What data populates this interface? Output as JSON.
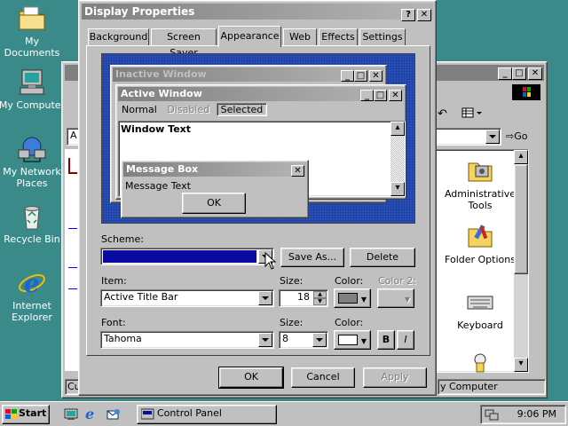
{
  "desktop": {
    "icons": [
      {
        "label": "My Documents"
      },
      {
        "label": "My Computer"
      },
      {
        "label": "My Network Places"
      },
      {
        "label": "Recycle Bin"
      },
      {
        "label": "Internet Explorer"
      }
    ]
  },
  "control_panel": {
    "go_label": "Go",
    "status_left": "Cus",
    "status_right": "y Computer",
    "address_prefix": "A",
    "items": [
      {
        "label": "Administrative Tools"
      },
      {
        "label": "Folder Options"
      },
      {
        "label": "Keyboard"
      }
    ]
  },
  "dialog": {
    "title": "Display Properties",
    "tabs": [
      "Background",
      "Screen Saver",
      "Appearance",
      "Web",
      "Effects",
      "Settings"
    ],
    "active_tab": "Appearance",
    "preview": {
      "inactive_title": "Inactive Window",
      "active_title": "Active Window",
      "menu_normal": "Normal",
      "menu_disabled": "Disabled",
      "menu_selected": "Selected",
      "window_text": "Window Text",
      "msgbox_title": "Message Box",
      "msgbox_text": "Message Text",
      "msgbox_ok": "OK"
    },
    "scheme_label": "Scheme:",
    "scheme_value": "",
    "save_as_label": "Save As...",
    "delete_label": "Delete",
    "item_label": "Item:",
    "item_value": "Active Title Bar",
    "size_label": "Size:",
    "item_size_value": "18",
    "color_label": "Color:",
    "color2_label": "Color 2:",
    "font_label": "Font:",
    "font_value": "Tahoma",
    "font_size_label": "Size:",
    "font_size_value": "8",
    "font_color_label": "Color:",
    "bold_label": "B",
    "italic_label": "I",
    "ok_label": "OK",
    "cancel_label": "Cancel",
    "apply_label": "Apply"
  },
  "taskbar": {
    "start_label": "Start",
    "task_label": "Control Panel",
    "clock": "9:06 PM"
  },
  "colors": {
    "desktop": "#3a8a8a",
    "scheme_selected": "#0a0aa0",
    "item_color": "#808080",
    "font_color": "#ffffff"
  }
}
